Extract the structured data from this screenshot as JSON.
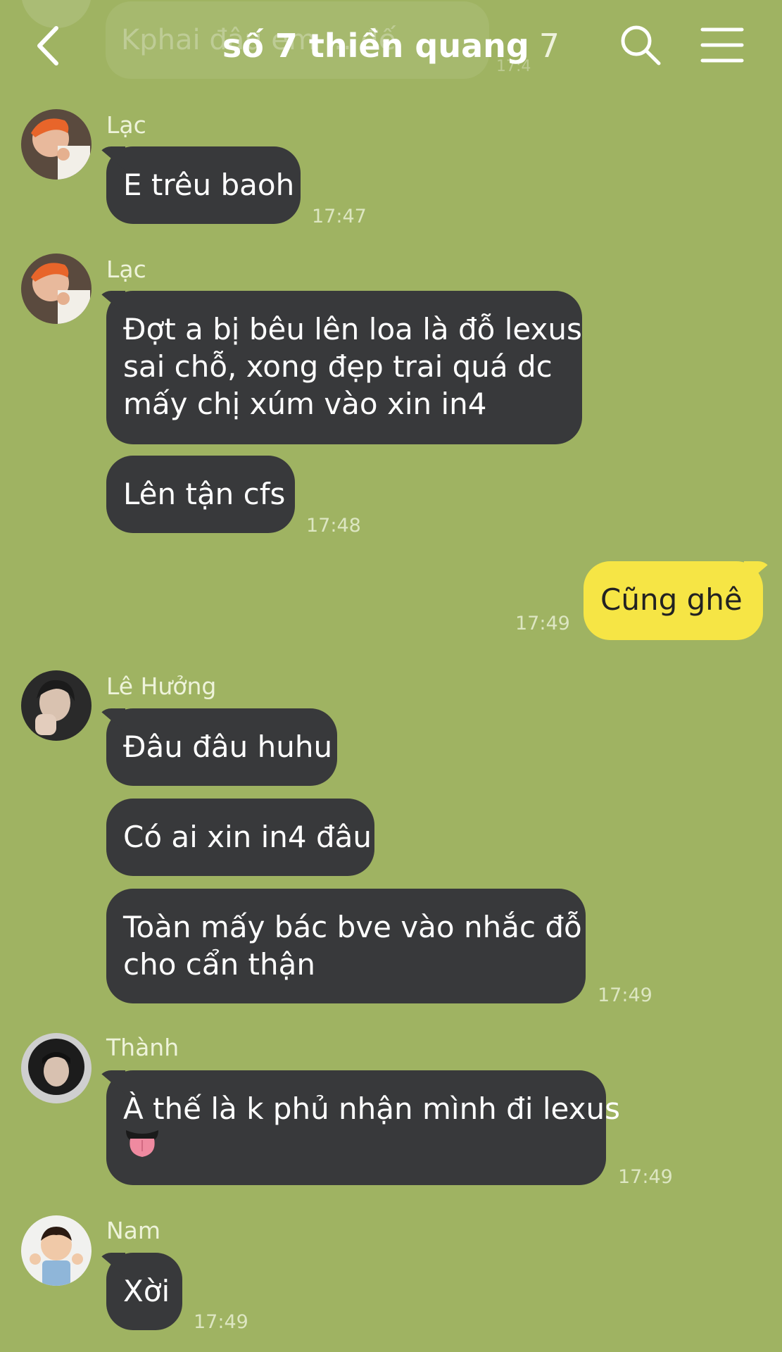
{
  "header": {
    "title": "số 7 thiền quang",
    "member_count": "7",
    "ghost_message": "Kphai đâu em ... đế"
  },
  "messages": [
    {
      "sender": "Lạc",
      "lines": [
        "E trêu baoh"
      ],
      "time": "17:47"
    },
    {
      "sender": "Lạc",
      "lines": [
        "Đợt a bị bêu lên loa là đỗ lexus",
        "sai chỗ, xong đẹp trai quá dc",
        "mấy chị xúm vào xin in4"
      ]
    },
    {
      "lines": [
        "Lên tận cfs"
      ],
      "time": "17:48"
    },
    {
      "mine": true,
      "lines": [
        "Cũng ghê"
      ],
      "time": "17:49"
    },
    {
      "sender": "Lê Hưởng",
      "lines": [
        "Đâu đâu huhu"
      ]
    },
    {
      "lines": [
        "Có ai xin in4 đâu"
      ]
    },
    {
      "lines": [
        "Toàn mấy bác bve vào nhắc đỗ",
        "cho cẩn thận"
      ],
      "time": "17:49"
    },
    {
      "sender": "Thành",
      "lines": [
        "À thế là k phủ nhận mình đi lexus"
      ],
      "emoji": "tongue-emoji",
      "time": "17:49"
    },
    {
      "sender": "Nam",
      "lines": [
        "Xời"
      ],
      "time": "17:49"
    }
  ],
  "colors": {
    "background": "#9fb362",
    "incoming_bubble": "#38393b",
    "outgoing_bubble": "#f6e545"
  },
  "icons": [
    "back-chevron-icon",
    "search-icon",
    "menu-icon"
  ]
}
